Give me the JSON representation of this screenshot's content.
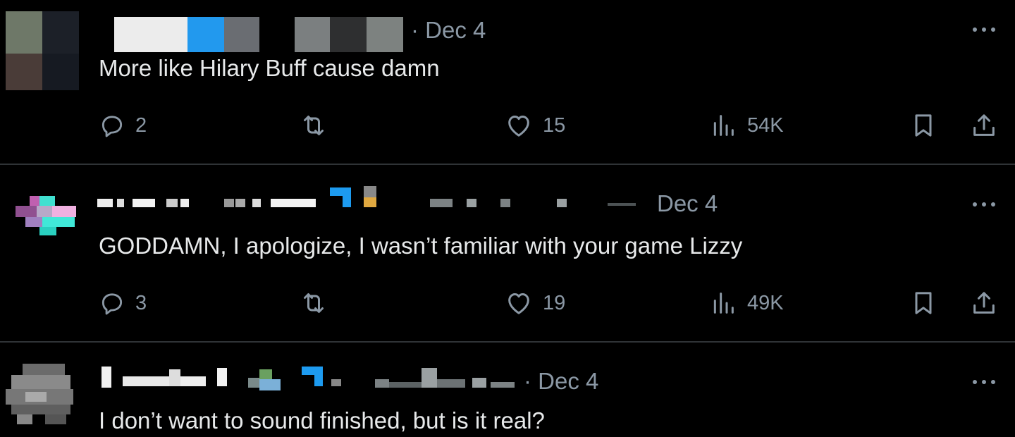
{
  "colors": {
    "background": "#000000",
    "text": "#e7e9ea",
    "muted": "#8b98a5",
    "divider": "#2f3336",
    "verified": "#1d9bf0"
  },
  "tweets": [
    {
      "date": "· Dec 4",
      "text": "More like Hilary Buff cause damn",
      "replies": "2",
      "reposts": "",
      "likes": "15",
      "views": "54K"
    },
    {
      "date": "Dec 4",
      "text": "GODDAMN, I apologize, I wasn’t familiar with your game Lizzy",
      "replies": "3",
      "reposts": "",
      "likes": "19",
      "views": "49K"
    },
    {
      "date": "· Dec 4",
      "text": "I don’t want to sound finished, but is it real?"
    }
  ],
  "icons": {
    "reply": "reply-icon",
    "repost": "repost-icon",
    "like": "heart-icon",
    "views": "views-icon",
    "bookmark": "bookmark-icon",
    "share": "share-icon",
    "more": "more-icon"
  }
}
